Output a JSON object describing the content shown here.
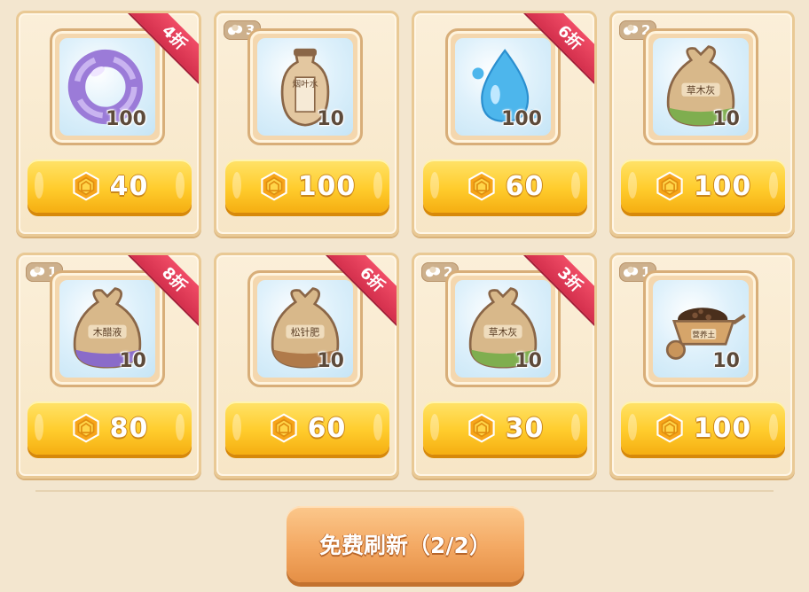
{
  "shop": {
    "items": [
      {
        "name": "purple-ring",
        "qty": "100",
        "price": "40",
        "discount": "4折",
        "limit": ""
      },
      {
        "name": "tobacco-water",
        "label": "烟叶水",
        "qty": "10",
        "price": "100",
        "discount": "",
        "limit": "3"
      },
      {
        "name": "water-drop",
        "qty": "100",
        "price": "60",
        "discount": "6折",
        "limit": ""
      },
      {
        "name": "plant-ash",
        "label": "草木灰",
        "qty": "10",
        "price": "100",
        "discount": "",
        "limit": "2"
      },
      {
        "name": "wood-vinegar",
        "label": "木醋液",
        "qty": "10",
        "price": "80",
        "discount": "8折",
        "limit": "1"
      },
      {
        "name": "pine-needle-fertilizer",
        "label": "松针肥",
        "qty": "10",
        "price": "60",
        "discount": "6折",
        "limit": ""
      },
      {
        "name": "plant-ash",
        "label": "草木灰",
        "qty": "10",
        "price": "30",
        "discount": "3折",
        "limit": "2"
      },
      {
        "name": "nutrient-soil",
        "label": "营养土",
        "qty": "10",
        "price": "100",
        "discount": "",
        "limit": "1"
      }
    ],
    "refresh_label": "免费刷新（2/2）"
  },
  "colors": {
    "background": "#f3e6cf",
    "price_button": "#ffcc2c",
    "ribbon": "#e03a57",
    "refresh_button": "#f3a862"
  }
}
